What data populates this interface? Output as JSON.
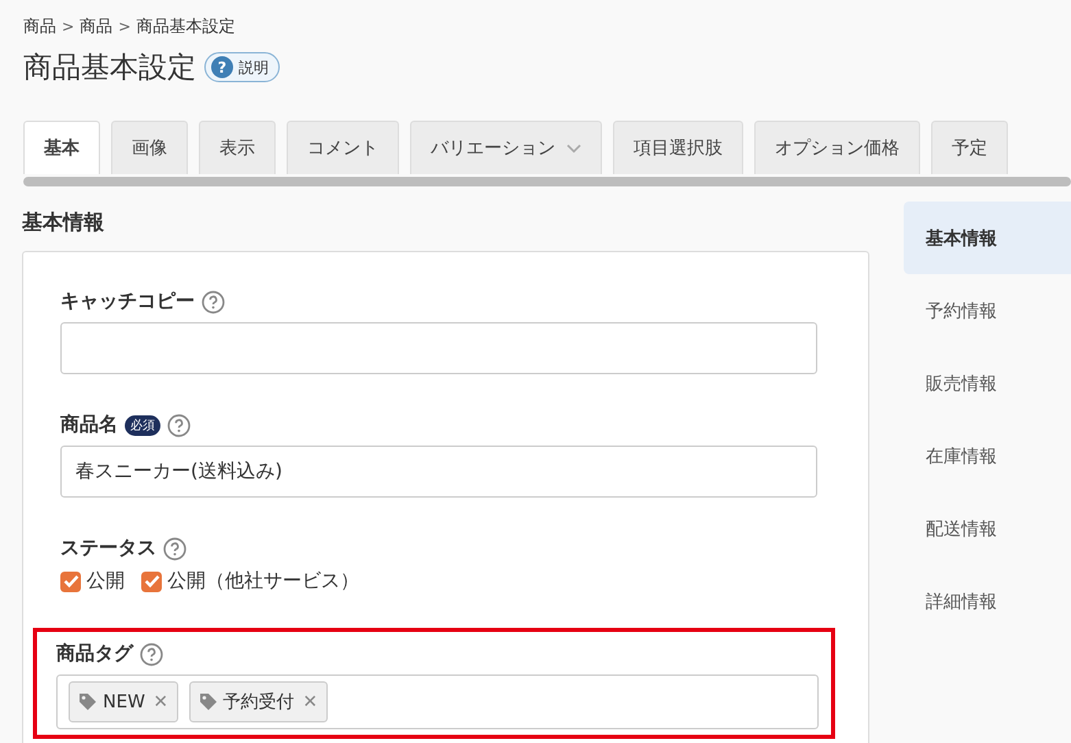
{
  "breadcrumb": [
    "商品",
    "商品",
    "商品基本設定"
  ],
  "breadcrumb_separator": ">",
  "title": "商品基本設定",
  "help_button": {
    "label": "説明",
    "icon_text": "?"
  },
  "tabs": [
    {
      "label": "基本",
      "selected": true,
      "dropdown": false
    },
    {
      "label": "画像",
      "selected": false,
      "dropdown": false
    },
    {
      "label": "表示",
      "selected": false,
      "dropdown": false
    },
    {
      "label": "コメント",
      "selected": false,
      "dropdown": false
    },
    {
      "label": "バリエーション",
      "selected": false,
      "dropdown": true
    },
    {
      "label": "項目選択肢",
      "selected": false,
      "dropdown": false
    },
    {
      "label": "オプション価格",
      "selected": false,
      "dropdown": false
    },
    {
      "label": "予定",
      "selected": false,
      "dropdown": false
    }
  ],
  "section_title": "基本情報",
  "fields": [
    {
      "kind": "text",
      "label": "キャッチコピー",
      "required": false,
      "highlighted": false
    },
    {
      "kind": "text",
      "label": "商品名",
      "required": true,
      "required_label": "必須",
      "value": "春スニーカー(送料込み)",
      "highlighted": false
    },
    {
      "kind": "checkboxes",
      "label": "ステータス",
      "required": false,
      "highlighted": false,
      "options": [
        {
          "label": "公開",
          "checked": true
        },
        {
          "label": "公開（他社サービス）",
          "checked": true
        }
      ]
    },
    {
      "kind": "tags",
      "label": "商品タグ",
      "required": false,
      "highlighted": true,
      "tags": [
        {
          "label": "NEW",
          "remove": "✕"
        },
        {
          "label": "予約受付",
          "remove": "✕"
        }
      ]
    }
  ],
  "side_nav": [
    {
      "label": "基本情報",
      "selected": true
    },
    {
      "label": "予約情報",
      "selected": false
    },
    {
      "label": "販売情報",
      "selected": false
    },
    {
      "label": "在庫情報",
      "selected": false
    },
    {
      "label": "配送情報",
      "selected": false
    },
    {
      "label": "詳細情報",
      "selected": false
    }
  ]
}
